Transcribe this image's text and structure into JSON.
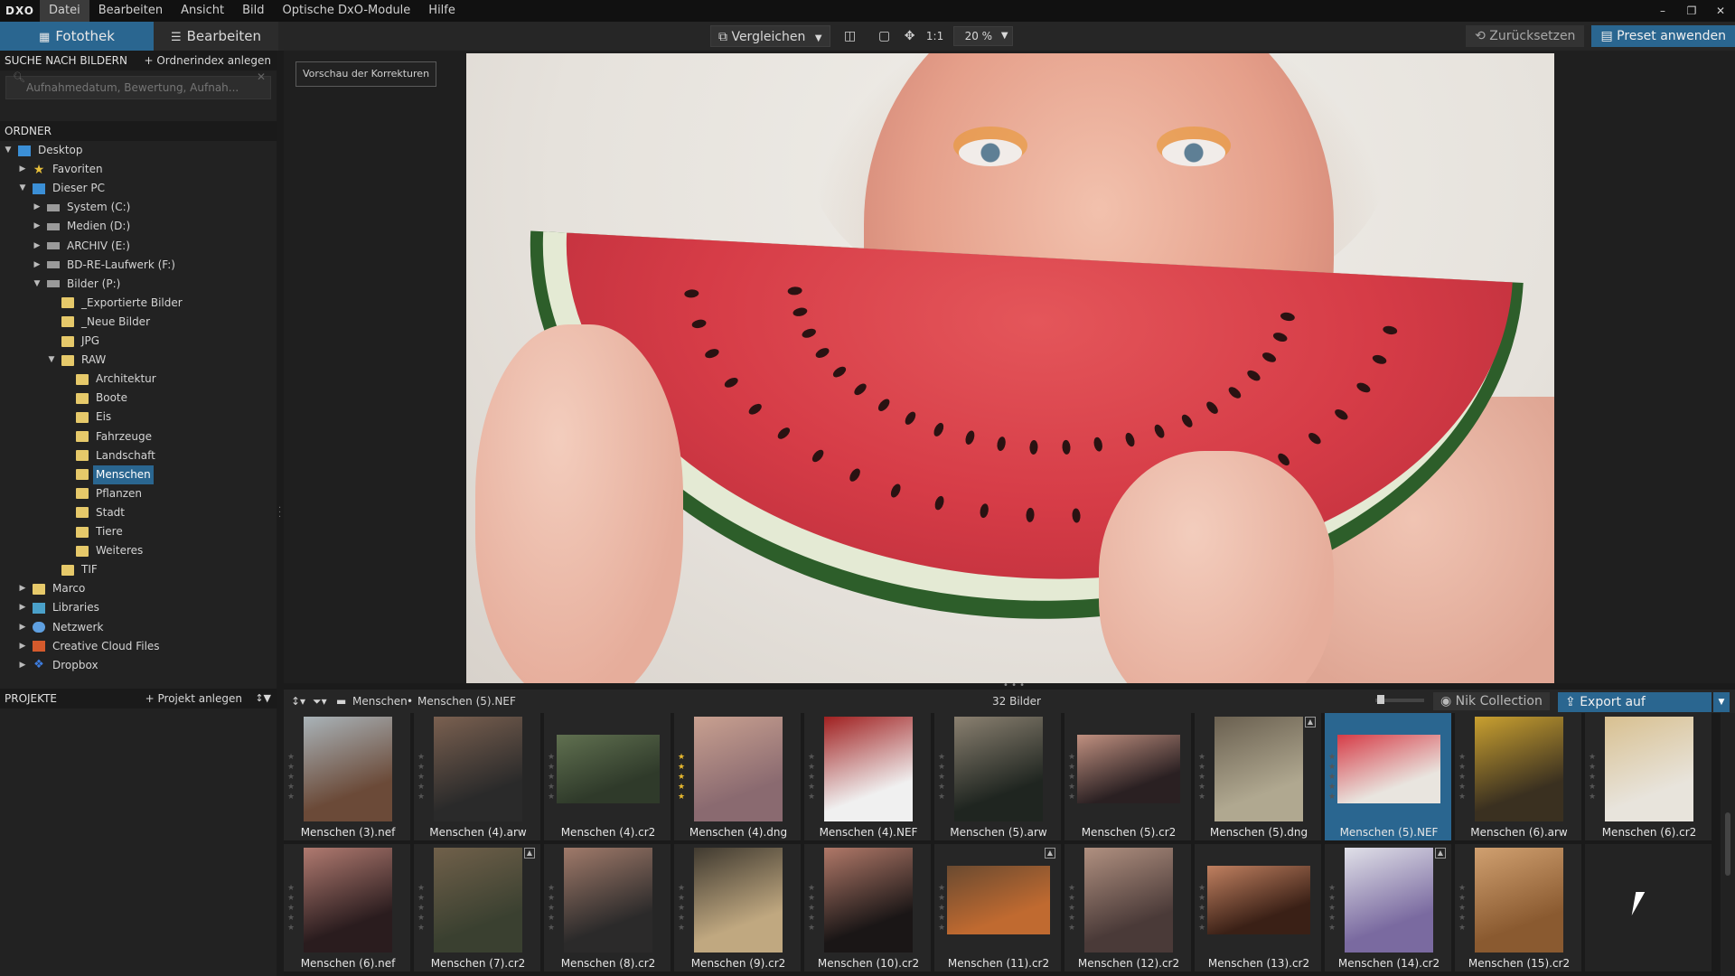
{
  "app": {
    "logo": "DXO",
    "menu": [
      "Datei",
      "Bearbeiten",
      "Ansicht",
      "Bild",
      "Optische DxO-Module",
      "Hilfe"
    ],
    "window_controls": [
      "–",
      "❐",
      "✕"
    ]
  },
  "toolbar": {
    "tab_fotothek": "Fotothek",
    "tab_bearbeiten": "Bearbeiten",
    "compare": "Vergleichen",
    "one_to_one": "1:1",
    "zoom": "20 %",
    "reset": "Zurücksetzen",
    "apply_preset": "Preset anwenden",
    "accent_color": "#2a6690"
  },
  "search": {
    "title": "SUCHE NACH BILDERN",
    "action": "+ Ordnerindex anlegen",
    "placeholder": "Aufnahmedatum, Bewertung, Aufnah..."
  },
  "folders": {
    "title": "ORDNER",
    "items": [
      {
        "label": "Desktop",
        "depth": 0,
        "arrow": "▼",
        "icon": "desktop-icon"
      },
      {
        "label": "Favoriten",
        "depth": 1,
        "arrow": "▶",
        "icon": "star-icon"
      },
      {
        "label": "Dieser PC",
        "depth": 1,
        "arrow": "▼",
        "icon": "computer-icon"
      },
      {
        "label": "System (C:)",
        "depth": 2,
        "arrow": "▶",
        "icon": "drive-icon"
      },
      {
        "label": "Medien (D:)",
        "depth": 2,
        "arrow": "▶",
        "icon": "drive-icon"
      },
      {
        "label": "ARCHIV (E:)",
        "depth": 2,
        "arrow": "▶",
        "icon": "drive-icon"
      },
      {
        "label": "BD-RE-Laufwerk (F:)",
        "depth": 2,
        "arrow": "▶",
        "icon": "disc-drive-icon"
      },
      {
        "label": "Bilder (P:)",
        "depth": 2,
        "arrow": "▼",
        "icon": "drive-icon"
      },
      {
        "label": "_Exportierte Bilder",
        "depth": 3,
        "arrow": "",
        "icon": "folder-icon"
      },
      {
        "label": "_Neue Bilder",
        "depth": 3,
        "arrow": "",
        "icon": "folder-icon"
      },
      {
        "label": "JPG",
        "depth": 3,
        "arrow": "",
        "icon": "folder-icon"
      },
      {
        "label": "RAW",
        "depth": 3,
        "arrow": "▼",
        "icon": "folder-icon"
      },
      {
        "label": "Architektur",
        "depth": 4,
        "arrow": "",
        "icon": "folder-icon"
      },
      {
        "label": "Boote",
        "depth": 4,
        "arrow": "",
        "icon": "folder-icon"
      },
      {
        "label": "Eis",
        "depth": 4,
        "arrow": "",
        "icon": "folder-icon"
      },
      {
        "label": "Fahrzeuge",
        "depth": 4,
        "arrow": "",
        "icon": "folder-icon"
      },
      {
        "label": "Landschaft",
        "depth": 4,
        "arrow": "",
        "icon": "folder-icon"
      },
      {
        "label": "Menschen",
        "depth": 4,
        "arrow": "",
        "icon": "folder-icon",
        "selected": true
      },
      {
        "label": "Pflanzen",
        "depth": 4,
        "arrow": "",
        "icon": "folder-icon"
      },
      {
        "label": "Stadt",
        "depth": 4,
        "arrow": "",
        "icon": "folder-icon"
      },
      {
        "label": "Tiere",
        "depth": 4,
        "arrow": "",
        "icon": "folder-icon"
      },
      {
        "label": "Weiteres",
        "depth": 4,
        "arrow": "",
        "icon": "folder-icon"
      },
      {
        "label": "TIF",
        "depth": 3,
        "arrow": "",
        "icon": "folder-icon"
      },
      {
        "label": "Marco",
        "depth": 1,
        "arrow": "▶",
        "icon": "folder-icon"
      },
      {
        "label": "Libraries",
        "depth": 1,
        "arrow": "▶",
        "icon": "libraries-icon"
      },
      {
        "label": "Netzwerk",
        "depth": 1,
        "arrow": "▶",
        "icon": "network-icon"
      },
      {
        "label": "Creative Cloud Files",
        "depth": 1,
        "arrow": "▶",
        "icon": "creative-cloud-icon"
      },
      {
        "label": "Dropbox",
        "depth": 1,
        "arrow": "▶",
        "icon": "dropbox-icon"
      }
    ]
  },
  "projects": {
    "title": "PROJEKTE",
    "action": "+ Projekt anlegen"
  },
  "viewer": {
    "preview_button": "Vorschau der Korrekturen"
  },
  "filmstrip": {
    "breadcrumb_folder": "Menschen",
    "breadcrumb_separator": "•",
    "breadcrumb_file": "Menschen (5).NEF",
    "count": "32 Bilder",
    "nik": "Nik Collection",
    "export": "Export auf Festplatte",
    "items": [
      {
        "name": "Menschen (3).nef",
        "c1": "#6b4a38",
        "c2": "#a9b3b8"
      },
      {
        "name": "Menschen (4).arw",
        "c1": "#2a2a2a",
        "c2": "#7a6050"
      },
      {
        "name": "Menschen (4).cr2",
        "c1": "#2f3a2a",
        "c2": "#607050",
        "wide": true
      },
      {
        "name": "Menschen (4).dng",
        "c1": "#8a6a70",
        "c2": "#c8a090",
        "gold": true
      },
      {
        "name": "Menschen (4).NEF",
        "c1": "#f0f0f0",
        "c2": "#a02020"
      },
      {
        "name": "Menschen (5).arw",
        "c1": "#1f2520",
        "c2": "#8a8070"
      },
      {
        "name": "Menschen (5).cr2",
        "c1": "#2a2022",
        "c2": "#c09080",
        "wide": true
      },
      {
        "name": "Menschen (5).dng",
        "c1": "#b0a890",
        "c2": "#6a6050",
        "badge": true
      },
      {
        "name": "Menschen (5).NEF",
        "c1": "#e9e5df",
        "c2": "#d63c47",
        "wide": true,
        "selected": true
      },
      {
        "name": "Menschen (6).arw",
        "c1": "#3a3020",
        "c2": "#c9a030"
      },
      {
        "name": "Menschen (6).cr2",
        "c1": "#e8e4dc",
        "c2": "#d8c090"
      },
      {
        "name": "Menschen (6).nef",
        "c1": "#2a1c1e",
        "c2": "#b07a70"
      },
      {
        "name": "Menschen (7).cr2",
        "c1": "#3a4030",
        "c2": "#70604a",
        "badge": true
      },
      {
        "name": "Menschen (8).cr2",
        "c1": "#2b2a2a",
        "c2": "#a07a6a"
      },
      {
        "name": "Menschen (9).cr2",
        "c1": "#c0a880",
        "c2": "#403a30"
      },
      {
        "name": "Menschen (10).cr2",
        "c1": "#1a1616",
        "c2": "#b07868"
      },
      {
        "name": "Menschen (11).cr2",
        "c1": "#c06a30",
        "c2": "#6a4a30",
        "wide": true,
        "badge": true
      },
      {
        "name": "Menschen (12).cr2",
        "c1": "#4a3a38",
        "c2": "#b09080"
      },
      {
        "name": "Menschen (13).cr2",
        "c1": "#3a2016",
        "c2": "#c08060",
        "wide": true
      },
      {
        "name": "Menschen (14).cr2",
        "c1": "#7a6aa0",
        "c2": "#e0e0e8",
        "badge": true
      },
      {
        "name": "Menschen (15).cr2",
        "c1": "#8a5a30",
        "c2": "#d0a070"
      }
    ]
  }
}
